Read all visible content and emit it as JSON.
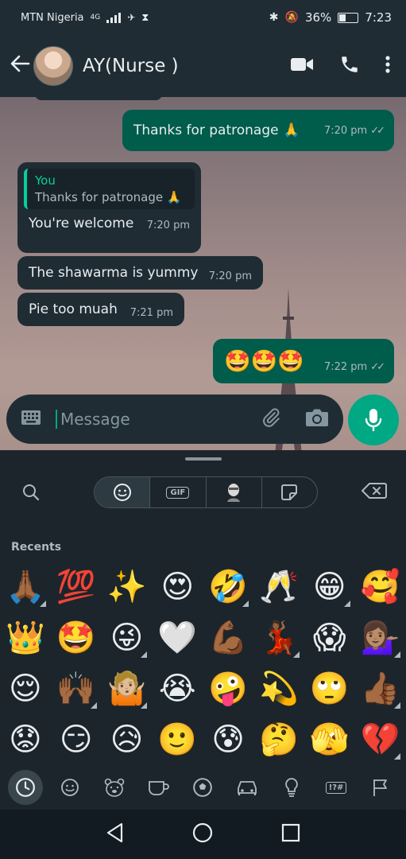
{
  "status_bar": {
    "carrier": "MTN Nigeria",
    "network": "4G",
    "battery": "36%",
    "time": "7:23"
  },
  "header": {
    "contact_name": "AY(Nurse )"
  },
  "messages": [
    {
      "direction": "out",
      "text": "Thanks for patronage 🙏",
      "time": "7:20 pm",
      "status": "read"
    },
    {
      "direction": "in",
      "quote_name": "You",
      "quote_text": "Thanks for patronage 🙏",
      "text": "You're welcome",
      "time": "7:20 pm"
    },
    {
      "direction": "in",
      "text": "The shawarma is yummy",
      "time": "7:20 pm"
    },
    {
      "direction": "in",
      "text": "Pie too muah",
      "time": "7:21 pm"
    },
    {
      "direction": "out",
      "text": "🤩🤩🤩",
      "time": "7:22 pm",
      "status": "read"
    }
  ],
  "composer": {
    "placeholder": "Message"
  },
  "keyboard": {
    "tabs": [
      "emoji",
      "GIF",
      "avatar",
      "sticker"
    ],
    "gif_label": "GIF",
    "section_label": "Recents",
    "emojis": [
      "🙏🏾",
      "💯",
      "✨",
      "😍",
      "🤣",
      "🥂",
      "😁",
      "🥰",
      "👑",
      "🤩",
      "😜",
      "🤍",
      "💪🏾",
      "💃🏾",
      "😱",
      "💁🏽‍♀️",
      "😌",
      "🙌🏾",
      "🤷🏼",
      "😭",
      "🤪",
      "💫",
      "🙄",
      "👍🏾",
      "😟",
      "😏",
      "😥",
      "🙂",
      "😰",
      "🤔",
      "🫣",
      "💔"
    ],
    "skin_tone_marked": [
      0,
      4,
      6,
      10,
      13,
      15,
      17,
      18,
      23,
      31
    ],
    "symbols_label": "!?#"
  },
  "colors": {
    "outgoing_bubble": "#005c4b",
    "incoming_bubble": "#1f2c34",
    "accent": "#00a884",
    "quote_accent": "#06cf9c"
  }
}
